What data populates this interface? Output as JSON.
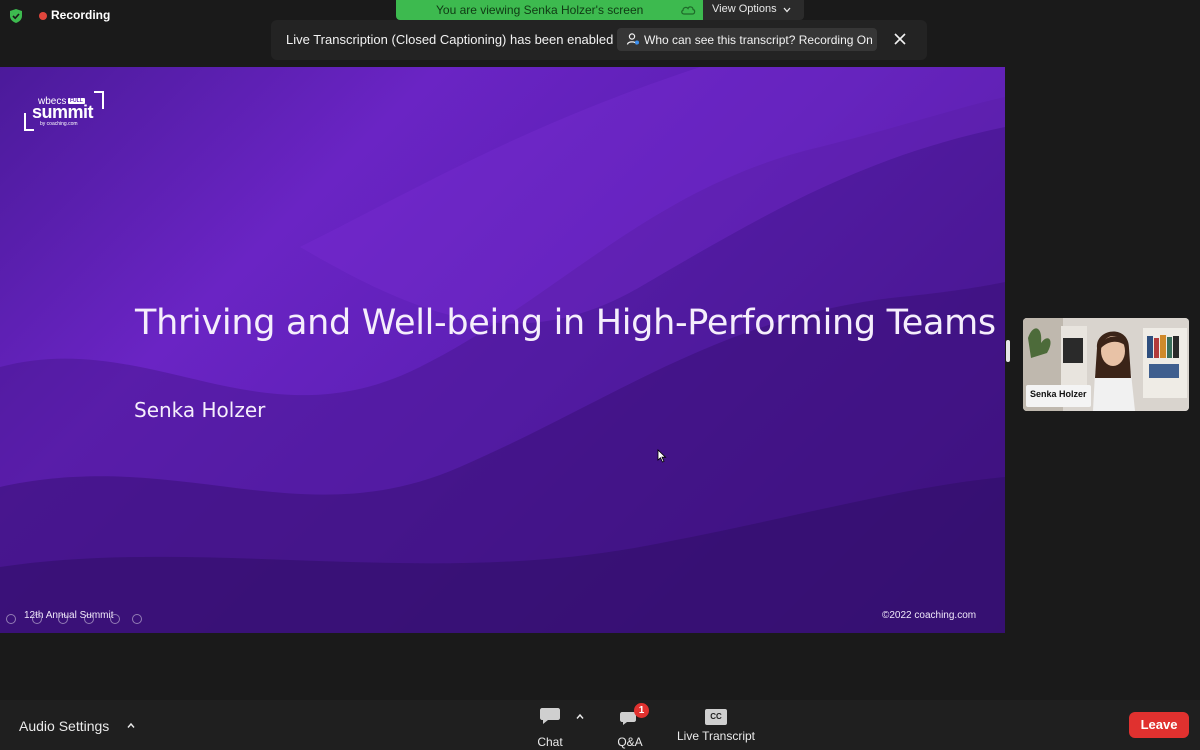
{
  "topbar": {
    "recording_label": "Recording",
    "viewing_banner": "You are viewing Senka Holzer's screen",
    "view_options_label": "View Options",
    "toast_text": "Live Transcription (Closed Captioning) has been enabled",
    "who_can_see_label": "Who can see this transcript? Recording On"
  },
  "slide": {
    "title": "Thriving and Well-being in High-Performing Teams",
    "presenter": "Senka Holzer",
    "footer_left": "12th Annual Summit",
    "footer_right": "©2022 coaching.com",
    "logo": {
      "wbecs": "wbecs",
      "full": "FULL",
      "summit": "summit",
      "by": "by coaching.com"
    }
  },
  "participant": {
    "name": "Senka Holzer"
  },
  "toolbar": {
    "audio_settings_label": "Audio Settings",
    "chat_label": "Chat",
    "qa_label": "Q&A",
    "qa_badge": "1",
    "live_transcript_label": "Live Transcript",
    "cc_text": "CC",
    "leave_label": "Leave"
  },
  "colors": {
    "recording_dot": "#e0463c",
    "viewing_banner": "#3dba4f",
    "leave_button": "#e0312f",
    "slide_purple": "#5b1fb3"
  },
  "icons": [
    "shield-check-icon",
    "cloud-icon",
    "chevron-down-icon",
    "person-icon",
    "close-icon",
    "chat-bubble-icon",
    "qa-bubble-icon",
    "cc-icon",
    "caret-up-icon"
  ]
}
